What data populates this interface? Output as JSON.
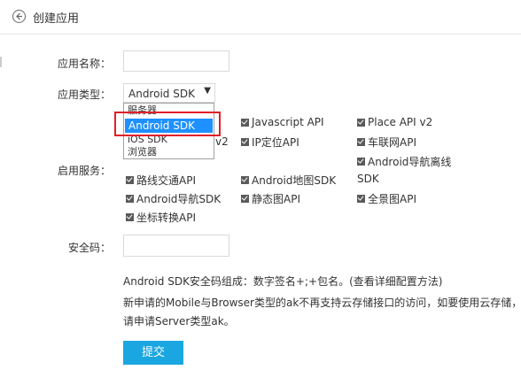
{
  "header": {
    "title": "创建应用"
  },
  "form": {
    "name_label": "应用名称：",
    "type_label": "应用类型：",
    "service_label": "启用服务：",
    "security_label": "安全码：",
    "selected_type": "Android SDK",
    "type_options": [
      "服务器",
      "Android SDK",
      "iOS SDK",
      "浏览器"
    ]
  },
  "services": {
    "javascript": "Javascript API",
    "place": "Place API v2",
    "v2_fragment": "v2",
    "ip": "IP定位API",
    "car": "车联网API",
    "android_nav_offline": "Android导航离线",
    "sdk_fragment": "SDK",
    "route": "路线交通API",
    "android_map": "Android地图SDK",
    "android_nav": "Android导航SDK",
    "static_map": "静态图API",
    "panorama": "全景图API",
    "coord": "坐标转换API"
  },
  "info": {
    "line1": "Android SDK安全码组成：数字签名+;+包名。(查看详细配置方法)",
    "line2": "新申请的Mobile与Browser类型的ak不再支持云存储接口的访问，如要使用云存储，",
    "line3": "请申请Server类型ak。"
  },
  "submit_label": "提交"
}
